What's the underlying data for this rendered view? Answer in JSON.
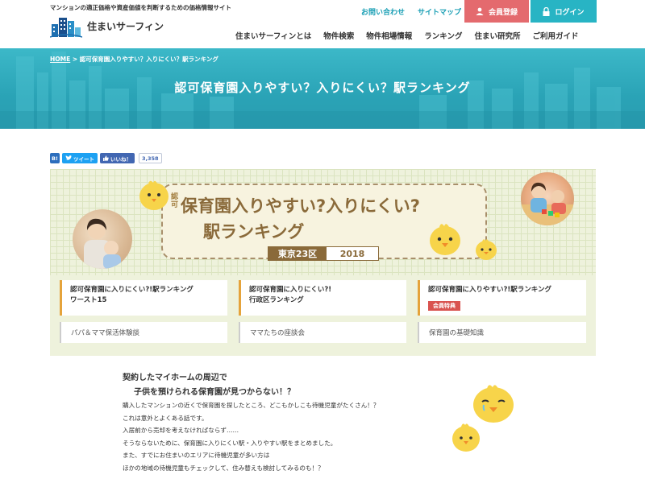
{
  "header": {
    "tagline": "マンションの適正価格や資産価値を判断するための価格情報サイト",
    "logo_text": "住まいサーフィン",
    "top_links": [
      "お問い合わせ",
      "サイトマップ"
    ],
    "register_label": "会員登録",
    "login_label": "ログイン",
    "nav": [
      "住まいサーフィンとは",
      "物件検索",
      "物件相場情報",
      "ランキング",
      "住まい研究所",
      "ご利用ガイド"
    ]
  },
  "hero": {
    "breadcrumb_home": "HOME",
    "breadcrumb_sep": ">",
    "breadcrumb_current": "認可保育園入りやすい？入りにくい？駅ランキング",
    "title": "認可保育園入りやすい？入りにくい？駅ランキング"
  },
  "social": {
    "hatena": "B!",
    "tweet": "ツイート",
    "like": "いいね！",
    "like_count": "3,358"
  },
  "banner": {
    "title_small": "認可",
    "title_line1": "保育園入りやすい?入りにくい?",
    "title_line2": "駅ランキング",
    "badge_left": "東京23区",
    "badge_right": "2018"
  },
  "cards": {
    "c1_line1": "認可保育園に入りにくい?!駅ランキング",
    "c1_line2": "ワースト15",
    "c2_line1": "認可保育園に入りにくい?!",
    "c2_line2": "行政区ランキング",
    "c3_line1": "認可保育園に入りやすい?!駅ランキング",
    "c3_tag": "会員特典",
    "p1": "パパ＆ママ保活体験談",
    "p2": "ママたちの座談会",
    "p3": "保育園の基礎知識"
  },
  "intro": {
    "heading1": "契約したマイホームの周辺で",
    "heading2": "子供を預けられる保育園が見つからない！？",
    "lines": [
      "購入したマンションの近くで保育園を探したところ、どこもかしこも待機児童がたくさん！？",
      "これは意外とよくある話です。",
      "入居前から売却を考えなければならず……",
      "そうならないために、保育園に入りにくい駅・入りやすい駅をまとめました。",
      "また、すでにお住まいのエリアに待機児童が多い方は",
      "ほかの地域の待機児童もチェックして、住み替えも検討してみるのも！？"
    ]
  },
  "colors": {
    "accent_teal": "#28b4c4",
    "register_red": "#e46a6e",
    "banner_bg": "#eef2dc",
    "title_brown": "#8a6a3a",
    "card_border": "#e5a33b"
  }
}
